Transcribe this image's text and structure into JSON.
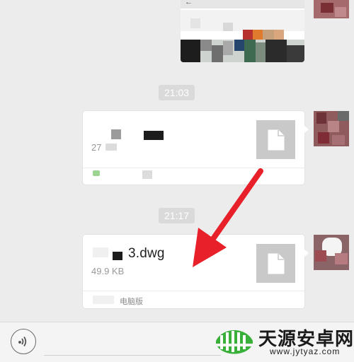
{
  "chat": {
    "messages": [
      {
        "type": "image"
      },
      {
        "type": "time",
        "text": "21:03"
      },
      {
        "type": "file",
        "name": "",
        "size": "27",
        "footer": ""
      },
      {
        "type": "time",
        "text": "21:17"
      },
      {
        "type": "file",
        "name": "3.dwg",
        "size": "49.9 KB",
        "footer": "电脑版"
      }
    ]
  },
  "watermark": {
    "title": "天源安卓网",
    "url": "www.jytyaz.com"
  },
  "colors": {
    "chat_background": "#ececec",
    "annotation_arrow": "#e8202a",
    "watermark_green": "#38b03a"
  },
  "icons": {
    "voice": "voice-icon",
    "file": "document-icon",
    "arrow": "red-arrow-annotation"
  }
}
